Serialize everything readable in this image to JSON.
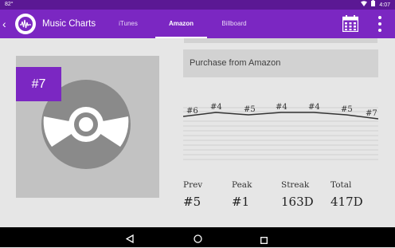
{
  "status_bar": {
    "temperature": "82°",
    "time": "4:07"
  },
  "app_bar": {
    "title": "Music Charts",
    "back_glyph": "‹",
    "logo_icon": "music-cd-logo-icon"
  },
  "tabs": [
    {
      "label": "iTunes",
      "active": false
    },
    {
      "label": "Amazon",
      "active": true
    },
    {
      "label": "Billboard",
      "active": false
    }
  ],
  "actions": {
    "calendar_icon": "calendar-icon",
    "overflow_icon": "more-vertical-icon"
  },
  "album": {
    "rank": "#7",
    "art_icon": "compact-disc-icon"
  },
  "purchase": {
    "label": "Purchase from Amazon"
  },
  "history": {
    "labels": [
      "#6",
      "#4",
      "#5",
      "#4",
      "#4",
      "#5",
      "#7"
    ]
  },
  "stats": [
    {
      "label": "Prev",
      "value": "#5"
    },
    {
      "label": "Peak",
      "value": "#1"
    },
    {
      "label": "Streak",
      "value": "163D"
    },
    {
      "label": "Total",
      "value": "417D"
    }
  ],
  "colors": {
    "primary": "#7b27c2",
    "status_bar": "#5b1894",
    "art_bg": "#c2c2c2",
    "disc": "#8a8a8a"
  }
}
